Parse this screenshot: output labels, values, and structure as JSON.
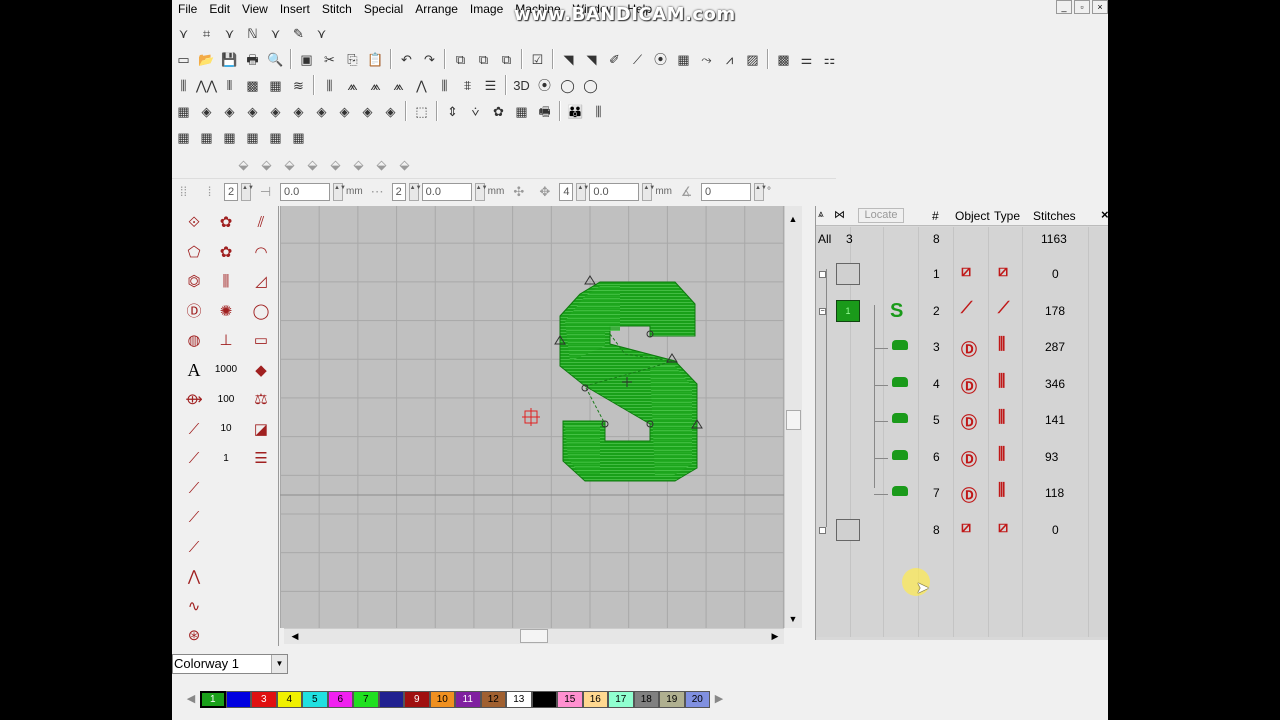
{
  "menu": [
    "File",
    "Edit",
    "View",
    "Insert",
    "Stitch",
    "Special",
    "Arrange",
    "Image",
    "Machine",
    "Window",
    "Help"
  ],
  "watermark": "www.BANDICAM.com",
  "window_controls": [
    "_",
    "▫",
    "×"
  ],
  "toolbar_row0": [
    "⋎",
    "⌗",
    "⋎",
    "ℕ",
    "⋎",
    "✎",
    "⋎"
  ],
  "toolbar_file": [
    "▭",
    "📂",
    "💾",
    "🖶",
    "🔍",
    "▣",
    "✂",
    "⎘",
    "📋",
    "↶",
    "↷",
    "⧉",
    "⧉",
    "⧉",
    "☑",
    "◥",
    "◥",
    "✐",
    "⟋",
    "⦿",
    "▦",
    "⤳",
    "⩘",
    "▨",
    "▩",
    "⚌",
    "⚏"
  ],
  "toolbar_stitch": [
    "⫼",
    "⋀⋀",
    "⫴",
    "▩",
    "▦",
    "≋",
    "⫼",
    "⩕",
    "⩕",
    "⩕",
    "⋀",
    "⫼",
    "⩨",
    "☰",
    "3D",
    "⦿",
    "◯",
    "◯"
  ],
  "toolbar_arrange": [
    "▦",
    "◈",
    "◈",
    "◈",
    "◈",
    "◈",
    "◈",
    "◈",
    "◈",
    "◈",
    "⬚",
    "⇕",
    "⩒",
    "✿",
    "▦",
    "🖷",
    "👪",
    "⫼"
  ],
  "toolbar_colors": [
    "▦",
    "▦",
    "▦",
    "▦",
    "▦",
    "▦"
  ],
  "toolbar_disabled": [
    "⬙",
    "⬙",
    "⬙",
    "⬙",
    "⬙",
    "⬙",
    "⬙",
    "⬙"
  ],
  "propbar": {
    "v1": "2",
    "v2": "0.0",
    "u2": "mm",
    "v3": "2",
    "v4": "0.0",
    "u4": "mm",
    "v5": "4",
    "v6": "0.0",
    "u6": "mm",
    "v7": "0",
    "u7": "°"
  },
  "left_tools": {
    "col1": [
      "⟐",
      "⬠",
      "⏣",
      "Ⓓ",
      "◍",
      "A",
      "⟴",
      "⟋",
      "⟋",
      "⟋",
      "⟋",
      "⟋",
      "⋀",
      "∿",
      "⊛"
    ],
    "col2": [
      "✿",
      "✿",
      "⫼",
      "✺",
      "⊥",
      "1000",
      "100",
      "10",
      "1"
    ],
    "col3": [
      "⫽",
      "◠",
      "◿",
      "◯",
      "▭",
      "◆",
      "⚖",
      "◪",
      "☰"
    ]
  },
  "canvas": {
    "letter": "S"
  },
  "sequence": {
    "locate_label": "Locate",
    "headers": {
      "num": "#",
      "object": "Object",
      "type": "Type",
      "stitches": "Stitches"
    },
    "all_row": {
      "label": "All",
      "count": "3",
      "num": "8",
      "stitches": "1163"
    },
    "rows": [
      {
        "num": "1",
        "stitches": "0",
        "group_label": "",
        "object_icon": "⧄",
        "type_icon": "⧄"
      },
      {
        "num": "2",
        "stitches": "178",
        "group_label": "1",
        "object_icon": "⟋",
        "type_icon": "⟋"
      },
      {
        "num": "3",
        "stitches": "287",
        "group_label": "",
        "object_icon": "Ⓓ",
        "type_icon": "⫼"
      },
      {
        "num": "4",
        "stitches": "346",
        "group_label": "",
        "object_icon": "Ⓓ",
        "type_icon": "⫼"
      },
      {
        "num": "5",
        "stitches": "141",
        "group_label": "",
        "object_icon": "Ⓓ",
        "type_icon": "⫼"
      },
      {
        "num": "6",
        "stitches": "93",
        "group_label": "",
        "object_icon": "Ⓓ",
        "type_icon": "⫼"
      },
      {
        "num": "7",
        "stitches": "118",
        "group_label": "",
        "object_icon": "Ⓓ",
        "type_icon": "⫼"
      },
      {
        "num": "8",
        "stitches": "0",
        "group_label": "",
        "object_icon": "⧄",
        "type_icon": "⧄"
      }
    ]
  },
  "colorway": "Colorway 1",
  "palette": [
    {
      "label": "1",
      "color": "#1aa01a"
    },
    {
      "label": "",
      "color": "#0000e0"
    },
    {
      "label": "3",
      "color": "#e01010"
    },
    {
      "label": "4",
      "color": "#f0f000"
    },
    {
      "label": "5",
      "color": "#20e0e0"
    },
    {
      "label": "6",
      "color": "#f020f0"
    },
    {
      "label": "7",
      "color": "#20e020"
    },
    {
      "label": "",
      "color": "#202090"
    },
    {
      "label": "9",
      "color": "#a01010"
    },
    {
      "label": "10",
      "color": "#f09020"
    },
    {
      "label": "11",
      "color": "#8020a0"
    },
    {
      "label": "12",
      "color": "#a06030"
    },
    {
      "label": "13",
      "color": "#ffffff"
    },
    {
      "label": "",
      "color": "#000000"
    },
    {
      "label": "15",
      "color": "#ff90d0"
    },
    {
      "label": "16",
      "color": "#ffd890"
    },
    {
      "label": "17",
      "color": "#90ffd0"
    },
    {
      "label": "18",
      "color": "#808080"
    },
    {
      "label": "19",
      "color": "#b0b090"
    },
    {
      "label": "20",
      "color": "#8090e0"
    }
  ]
}
